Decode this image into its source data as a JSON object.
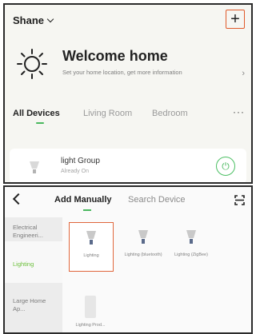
{
  "top": {
    "user_name": "Shane",
    "add_symbol": "+",
    "welcome_title": "Welcome home",
    "welcome_subtitle": "Set your home location, get more information",
    "welcome_arrow": "›",
    "tabs": [
      "All Devices",
      "Living Room",
      "Bedroom"
    ],
    "more": "···",
    "device": {
      "name": "light Group",
      "status": "Already On",
      "power_symbol": "⏻"
    }
  },
  "bottom": {
    "tabs": {
      "add_manually": "Add Manually",
      "search_device": "Search Device"
    },
    "sidebar": [
      {
        "label": "Electrical Engineeri..."
      },
      {
        "label": "Lighting"
      },
      {
        "label": "Large Home Ap..."
      }
    ],
    "items": [
      {
        "label": "Lighting"
      },
      {
        "label": "Lighting (bluetooth)"
      },
      {
        "label": "Lighting (ZigBee)"
      },
      {
        "label": "Lighting Prod..."
      }
    ]
  },
  "colors": {
    "accent_green": "#49b85e",
    "highlight_orange": "#e05a2a",
    "text": "#222222"
  }
}
